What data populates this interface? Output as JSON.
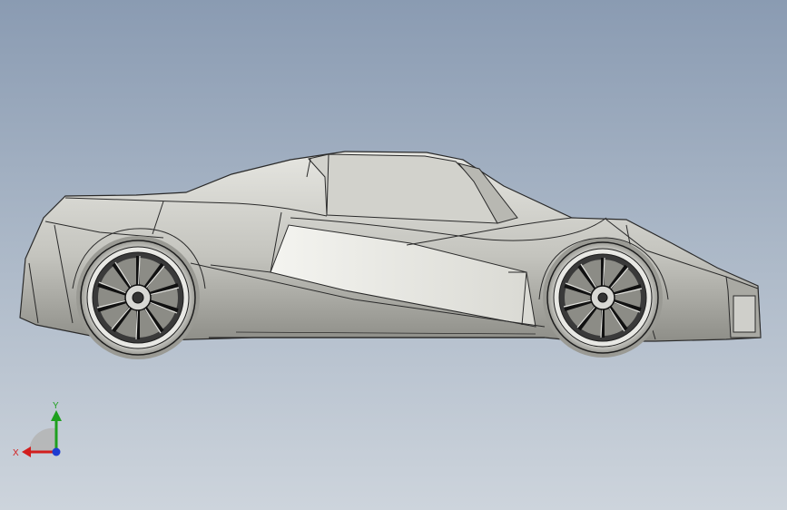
{
  "viewport": {
    "background_top": "#8a9bb2",
    "background_bottom": "#cdd4dc",
    "model_color": "#c9c9c3",
    "edge_color": "#1e1e1e"
  },
  "model": {
    "icon": "car-side-view-icon"
  },
  "triad": {
    "x_label": "X",
    "y_label": "Y",
    "x_color": "#d21e1e",
    "y_color": "#1ea01e",
    "z_color": "#1e3cd2"
  }
}
